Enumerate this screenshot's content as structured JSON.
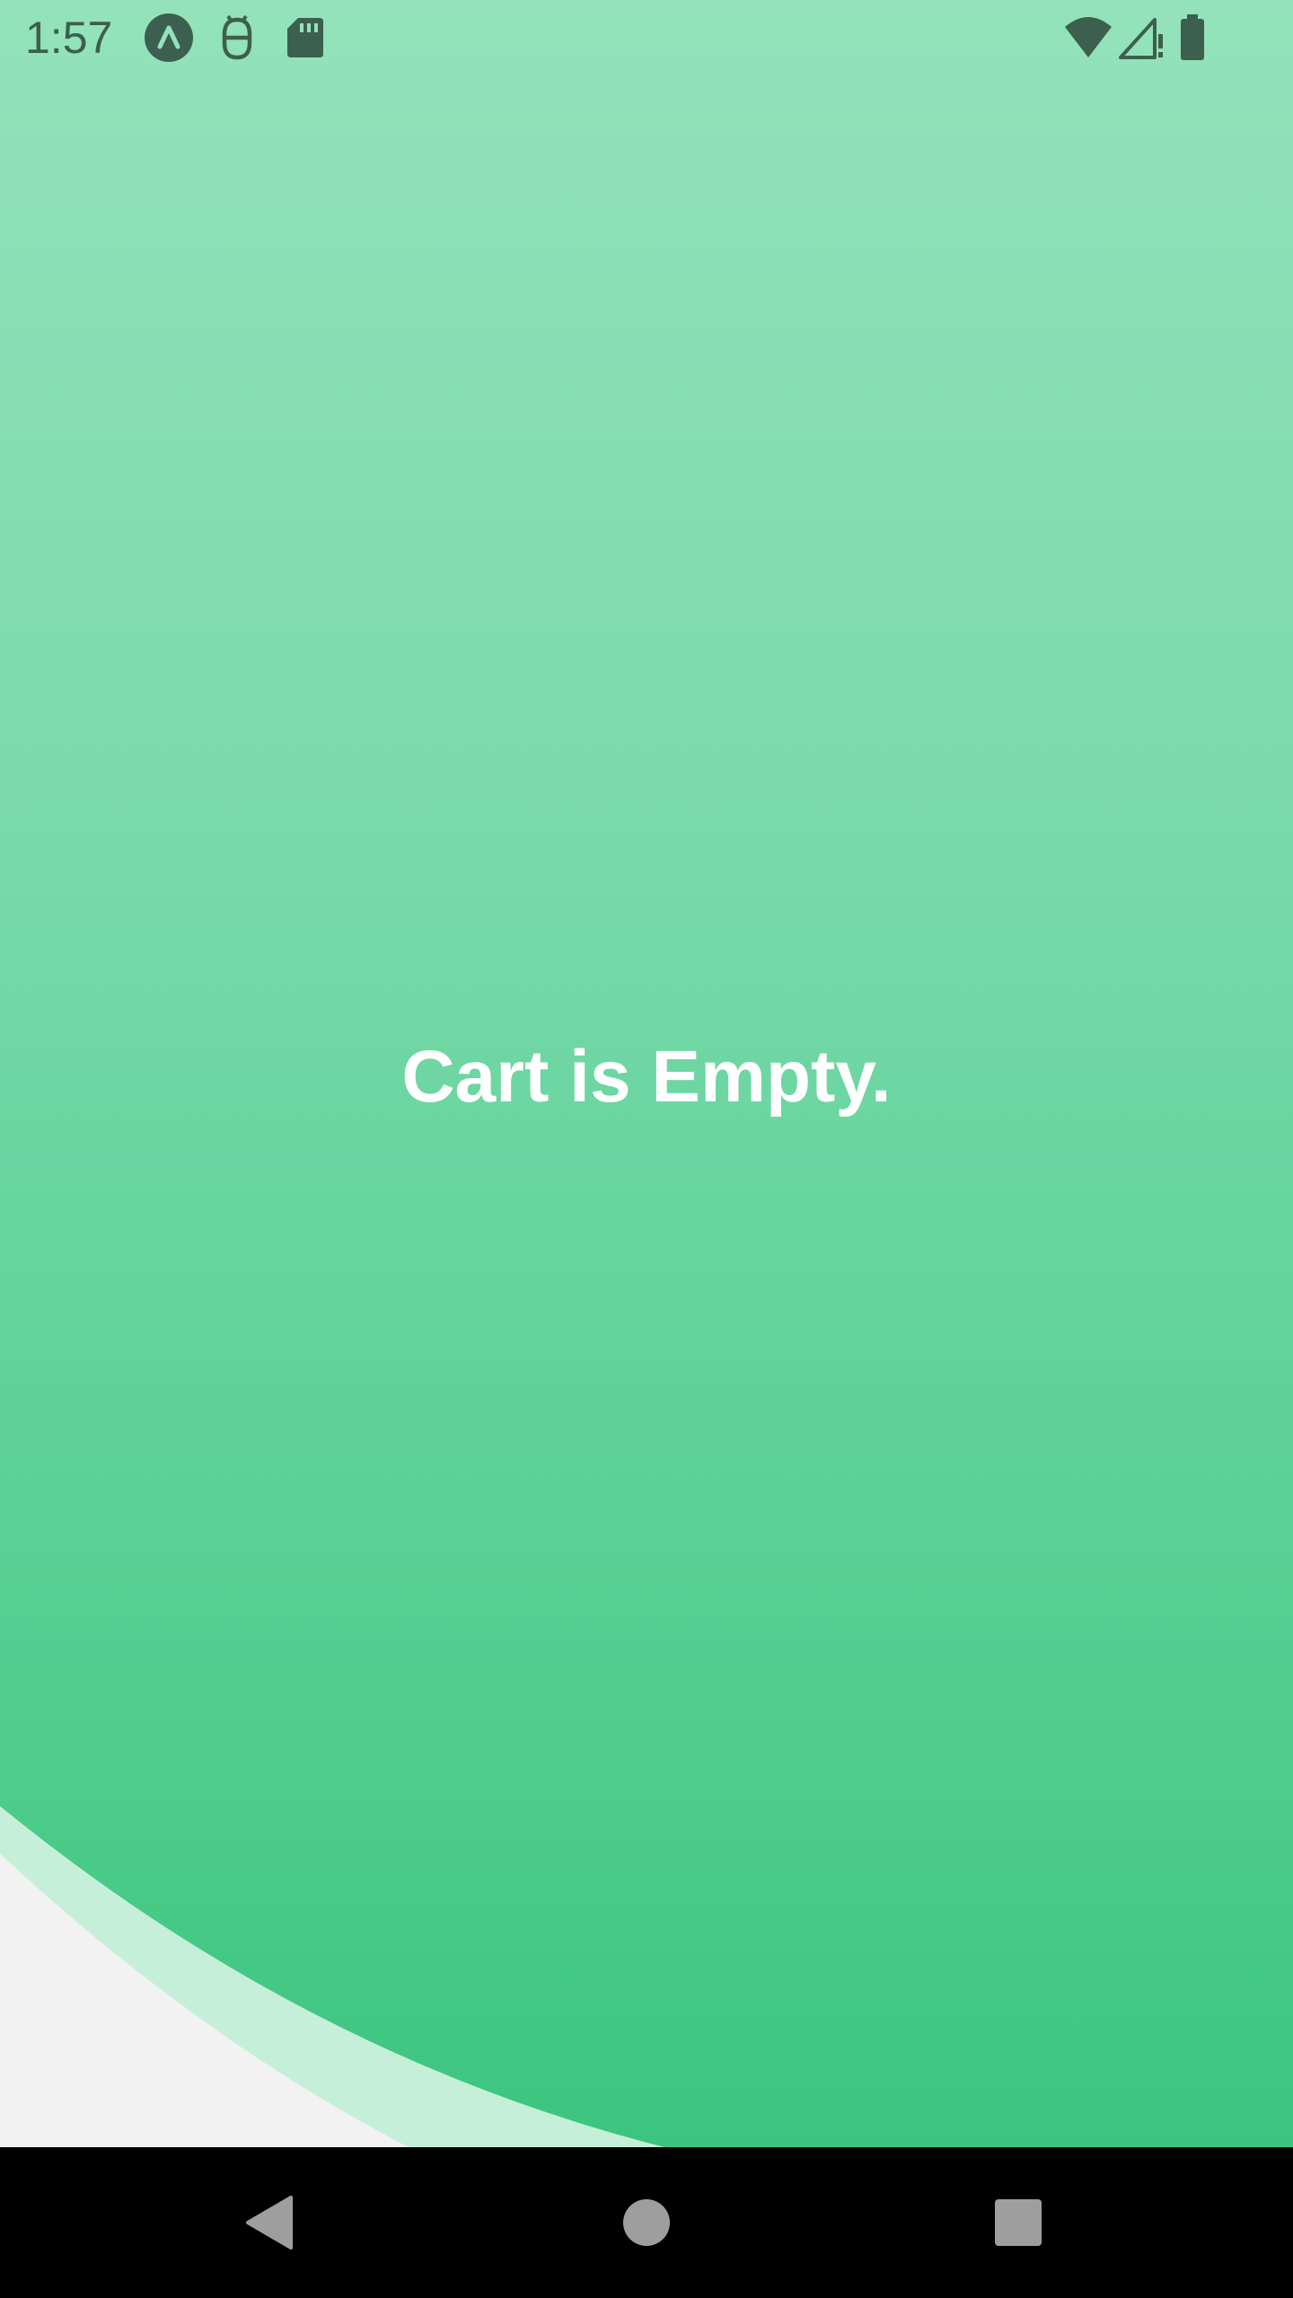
{
  "status_bar": {
    "time": "1:57",
    "left_icons": [
      "app-notification-icon",
      "android-debug-icon",
      "sd-card-icon"
    ],
    "right_icons": [
      "wifi-icon",
      "cellular-signal-icon",
      "battery-icon"
    ]
  },
  "main": {
    "empty_message": "Cart is Empty."
  },
  "nav_bar": {
    "buttons": [
      "back-icon",
      "home-icon",
      "recents-icon"
    ]
  },
  "colors": {
    "gradient_top": "#93e2bb",
    "gradient_bottom": "#3cc57f",
    "wave_light": "#c6efd9",
    "wave_base": "#f2f2f2",
    "status_icon": "#3d5f4f",
    "nav_button": "#9e9e9e",
    "nav_background": "#000000",
    "message_text": "#ffffff"
  }
}
